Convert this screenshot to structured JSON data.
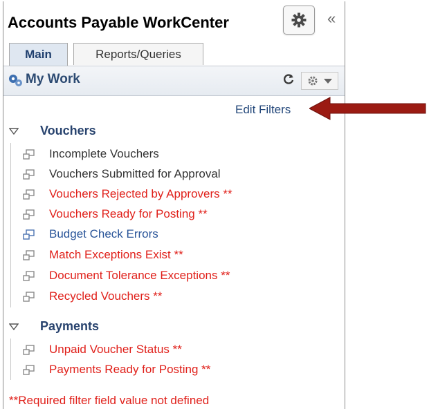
{
  "workcenter": {
    "title": "Accounts Payable WorkCenter",
    "collapse_glyph": "«",
    "gear_icon": "gear-icon"
  },
  "tabs": [
    {
      "label": "Main",
      "active": true
    },
    {
      "label": "Reports/Queries",
      "active": false
    }
  ],
  "my_work": {
    "title": "My Work",
    "edit_filters": "Edit Filters"
  },
  "sections": [
    {
      "label": "Vouchers",
      "items": [
        {
          "label": "Incomplete Vouchers",
          "color": "#333333"
        },
        {
          "label": "Vouchers Submitted for Approval",
          "color": "#333333"
        },
        {
          "label": "Vouchers Rejected by Approvers **",
          "color": "#e0201a"
        },
        {
          "label": "Vouchers Ready for Posting **",
          "color": "#e0201a"
        },
        {
          "label": "Budget Check Errors",
          "color": "#2a5599"
        },
        {
          "label": "Match Exceptions Exist **",
          "color": "#e0201a"
        },
        {
          "label": "Document Tolerance Exceptions **",
          "color": "#e0201a"
        },
        {
          "label": "Recycled Vouchers **",
          "color": "#e0201a"
        }
      ]
    },
    {
      "label": "Payments",
      "items": [
        {
          "label": "Unpaid Voucher Status **",
          "color": "#e0201a"
        },
        {
          "label": "Payments Ready for Posting **",
          "color": "#e0201a"
        }
      ]
    }
  ],
  "footnote": "**Required filter field value not defined",
  "annotation": {
    "arrow_color": "#9b1b13"
  }
}
